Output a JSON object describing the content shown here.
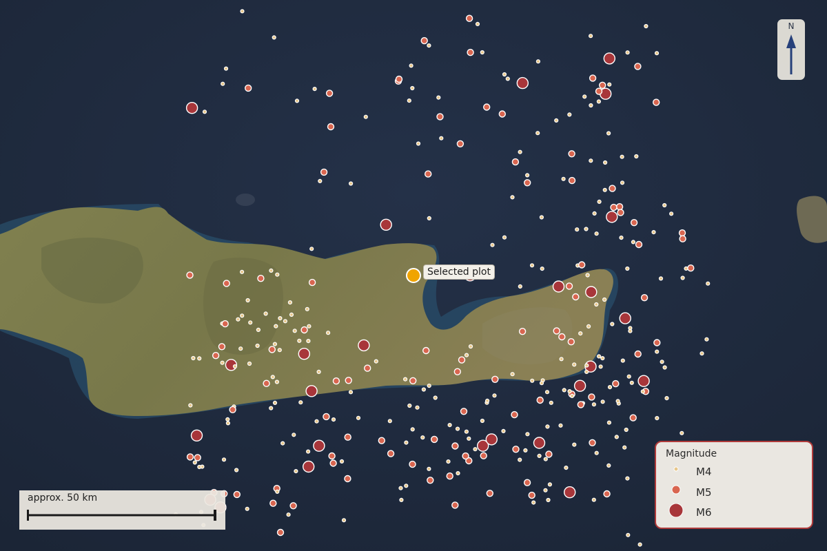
{
  "map": {
    "colors": {
      "sea": "#1f2a3c",
      "land": "#7c7a4f",
      "shallows": "#2c5a78",
      "m4": "#e8c78a",
      "m5": "#d96650",
      "m6": "#a8363a",
      "selected": "#f0a400",
      "legend_border": "#b03a3a"
    }
  },
  "north_arrow": {
    "label": "N",
    "icon": "north-arrow-icon"
  },
  "selected_plot": {
    "label": "Selected plot",
    "icon": "selected-plot-marker-icon"
  },
  "scale_bar": {
    "label": "approx. 50 km"
  },
  "legend": {
    "title": "Magnitude",
    "items": [
      {
        "label": "M4",
        "magnitude": 4,
        "icon": "m4-circle-icon"
      },
      {
        "label": "M5",
        "magnitude": 5,
        "icon": "m5-circle-icon"
      },
      {
        "label": "M6",
        "magnitude": 6,
        "icon": "m6-circle-icon"
      }
    ]
  }
}
